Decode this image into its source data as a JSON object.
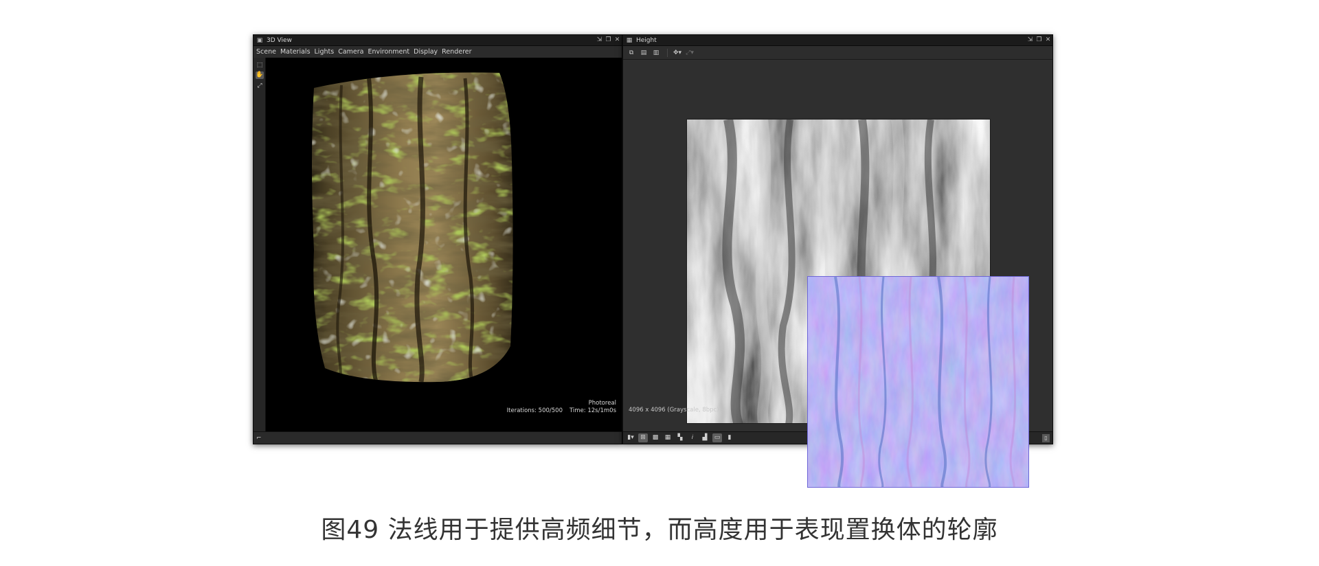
{
  "panel_3d": {
    "title": "3D View",
    "title_icon": "cube-icon",
    "menu": [
      "Scene",
      "Materials",
      "Lights",
      "Camera",
      "Environment",
      "Display",
      "Renderer"
    ],
    "tools": [
      "select-icon",
      "hand-icon",
      "pick-icon"
    ],
    "render_info": {
      "mode": "Photoreal",
      "iterations": "Iterations: 500/500",
      "time": "Time: 12s/1m0s"
    }
  },
  "panel_height": {
    "title": "Height",
    "title_icon": "image-icon",
    "image_info": "4096 x 4096 (Grayscale, 8bpc)",
    "toolbar_icons": [
      "copy-icon",
      "save-icon",
      "export-icon",
      "fit-icon",
      "zoom-icon"
    ],
    "bottom_icons": [
      "channels-icon",
      "tiling-icon",
      "color-icon",
      "grid-icon",
      "checker-icon",
      "info-icon",
      "histogram-icon",
      "compare-icon",
      "rgb-icon"
    ]
  },
  "window_buttons": [
    "pin-icon",
    "restore-icon",
    "close-icon"
  ],
  "caption": "图49 法线用于提供高频细节，而高度用于表现置换体的轮廓",
  "colors": {
    "bark_base": "#6b5a38",
    "moss": "#6c8f1e",
    "normal_map": "#8a83ee",
    "height_mid": "#9a9a9a"
  }
}
